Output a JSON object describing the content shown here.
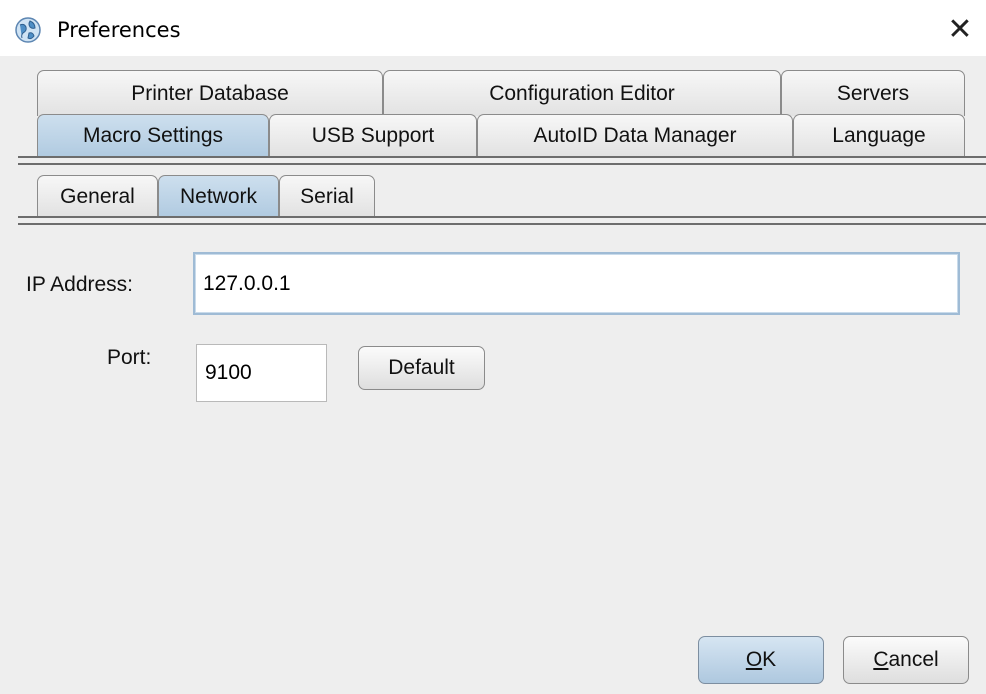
{
  "window": {
    "title": "Preferences",
    "close_glyph": "✕"
  },
  "tabs": {
    "row1": [
      {
        "label": "Printer Database"
      },
      {
        "label": "Configuration Editor"
      },
      {
        "label": "Servers"
      }
    ],
    "row2": [
      {
        "label": "Macro Settings",
        "selected": true
      },
      {
        "label": "USB Support"
      },
      {
        "label": "AutoID Data Manager"
      },
      {
        "label": "Language"
      }
    ],
    "subtabs": [
      {
        "label": "General"
      },
      {
        "label": "Network",
        "selected": true
      },
      {
        "label": "Serial"
      }
    ]
  },
  "network": {
    "ip_label": "IP Address:",
    "ip_value": "127.0.0.1",
    "port_label": "Port:",
    "port_value": "9100",
    "default_label": "Default"
  },
  "footer": {
    "ok_mnemonic": "O",
    "ok_rest": "K",
    "cancel_mnemonic": "C",
    "cancel_rest": "ancel"
  },
  "icons": {
    "app": "app-globe-icon",
    "close": "close-icon"
  },
  "colors": {
    "selected_tab": "#b9d1e6",
    "focus_border": "#9fbbd5",
    "background": "#eeeeee"
  }
}
